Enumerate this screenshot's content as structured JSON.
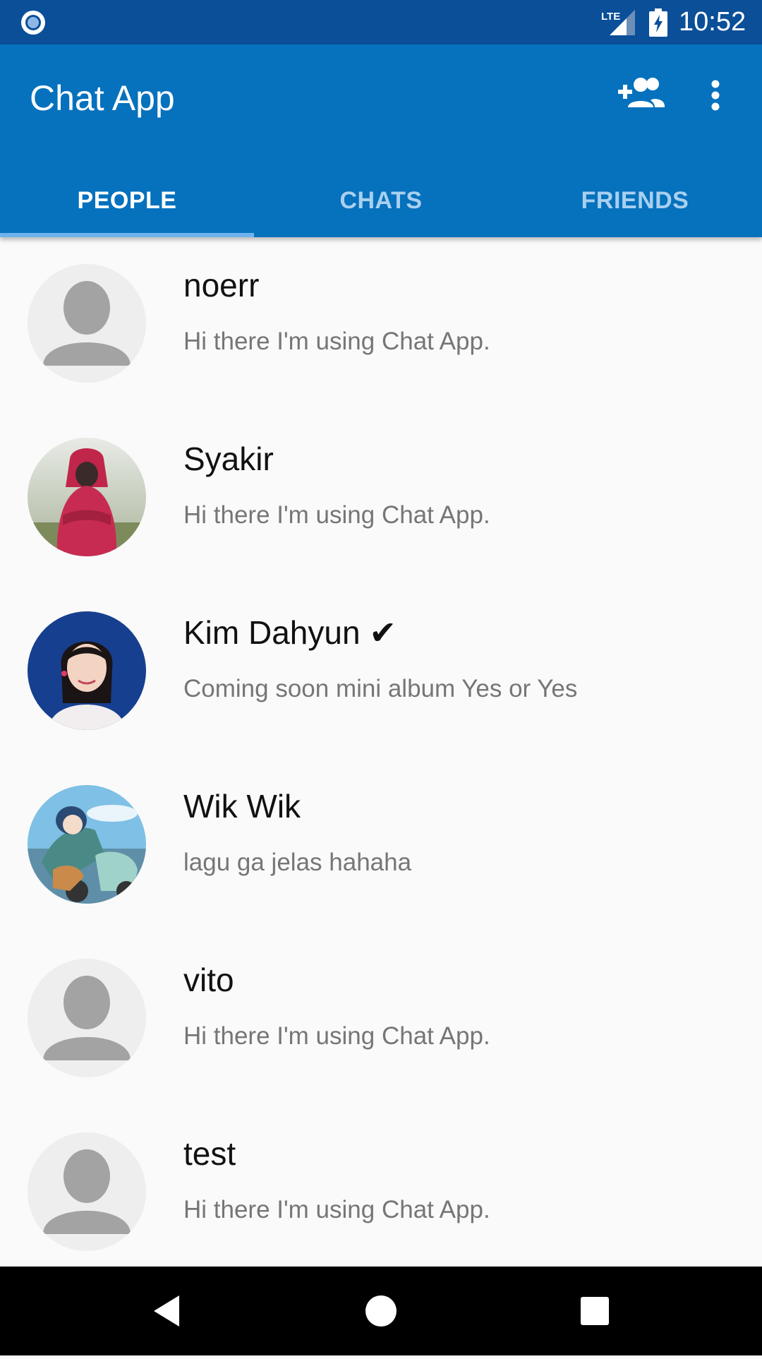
{
  "status_bar": {
    "time": "10:52",
    "network_label": "LTE",
    "icons": [
      "notification-icon",
      "lte-signal-icon",
      "battery-charging-icon"
    ]
  },
  "app_bar": {
    "title": "Chat App",
    "actions": [
      "add-person-icon",
      "overflow-menu-icon"
    ],
    "color": "#0671bd"
  },
  "tabs": [
    {
      "label": "PEOPLE",
      "active": true
    },
    {
      "label": "CHATS",
      "active": false
    },
    {
      "label": "FRIENDS",
      "active": false
    }
  ],
  "people": [
    {
      "name": "noerr",
      "status": "Hi there I'm using Chat App.",
      "avatar": "default-avatar"
    },
    {
      "name": "Syakir",
      "status": "Hi there I'm using Chat App.",
      "avatar": "photo-red-hoodie"
    },
    {
      "name": "Kim Dahyun ✔",
      "status": "Coming soon mini album Yes or Yes",
      "avatar": "photo-portrait"
    },
    {
      "name": "Wik Wik",
      "status": "lagu ga jelas hahaha",
      "avatar": "photo-anime-scooter"
    },
    {
      "name": "vito",
      "status": "Hi there I'm using Chat App.",
      "avatar": "default-avatar"
    },
    {
      "name": "test",
      "status": "Hi there I'm using Chat App.",
      "avatar": "default-avatar"
    }
  ],
  "nav_bar": {
    "buttons": [
      "back-icon",
      "home-icon",
      "recents-icon"
    ]
  }
}
